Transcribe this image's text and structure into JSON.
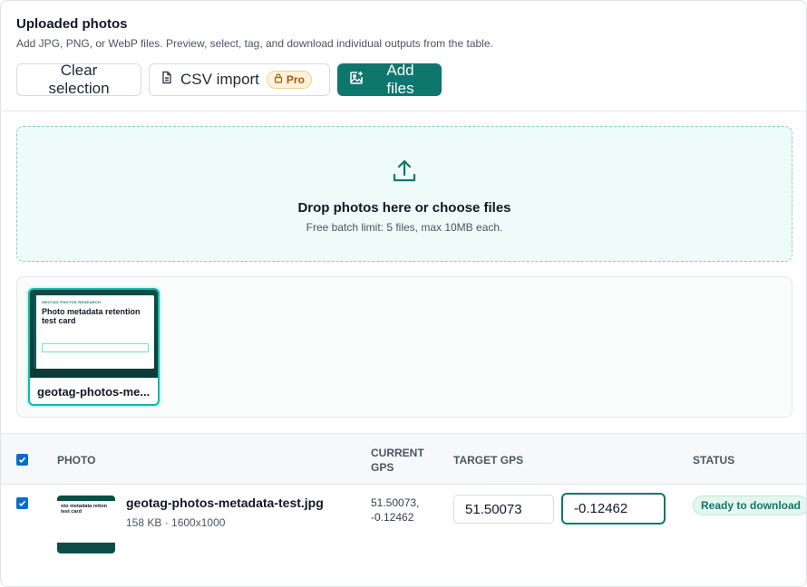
{
  "header": {
    "title": "Uploaded photos",
    "subtitle": "Add JPG, PNG, or WebP files. Preview, select, tag, and download individual outputs from the table."
  },
  "toolbar": {
    "clear_label": "Clear selection",
    "csv_label": "CSV import",
    "pro_label": "Pro",
    "add_label": "Add files"
  },
  "dropzone": {
    "title": "Drop photos here or choose files",
    "subtitle": "Free batch limit: 5 files, max 10MB each."
  },
  "gallery": {
    "items": [
      {
        "name": "geotag-photos-me...",
        "card_eyebrow": "GEOTAG PHOTOS RESEARCH",
        "card_title": "Photo metadata retention test card"
      }
    ]
  },
  "table": {
    "columns": {
      "photo": "PHOTO",
      "current_gps": "CURRENT GPS",
      "target_gps": "TARGET GPS",
      "status": "STATUS"
    },
    "rows": [
      {
        "file_name": "geotag-photos-metadata-test.jpg",
        "meta": "158 KB · 1600x1000",
        "current_gps_lat": "51.50073,",
        "current_gps_lng": "-0.12462",
        "target_lat": "51.50073",
        "target_lng": "-0.12462",
        "status": "Ready to download",
        "thumb_title": "oto metadata retion test card"
      }
    ]
  },
  "colors": {
    "accent": "#0f766e",
    "checkbox": "#0b6bcb",
    "dropzone_bg": "#effbf8",
    "pro_badge": "#b45309"
  },
  "icons": {
    "csv": "document-icon",
    "pro": "lock-icon",
    "add": "image-plus-icon",
    "upload": "upload-icon",
    "check": "check-icon"
  }
}
